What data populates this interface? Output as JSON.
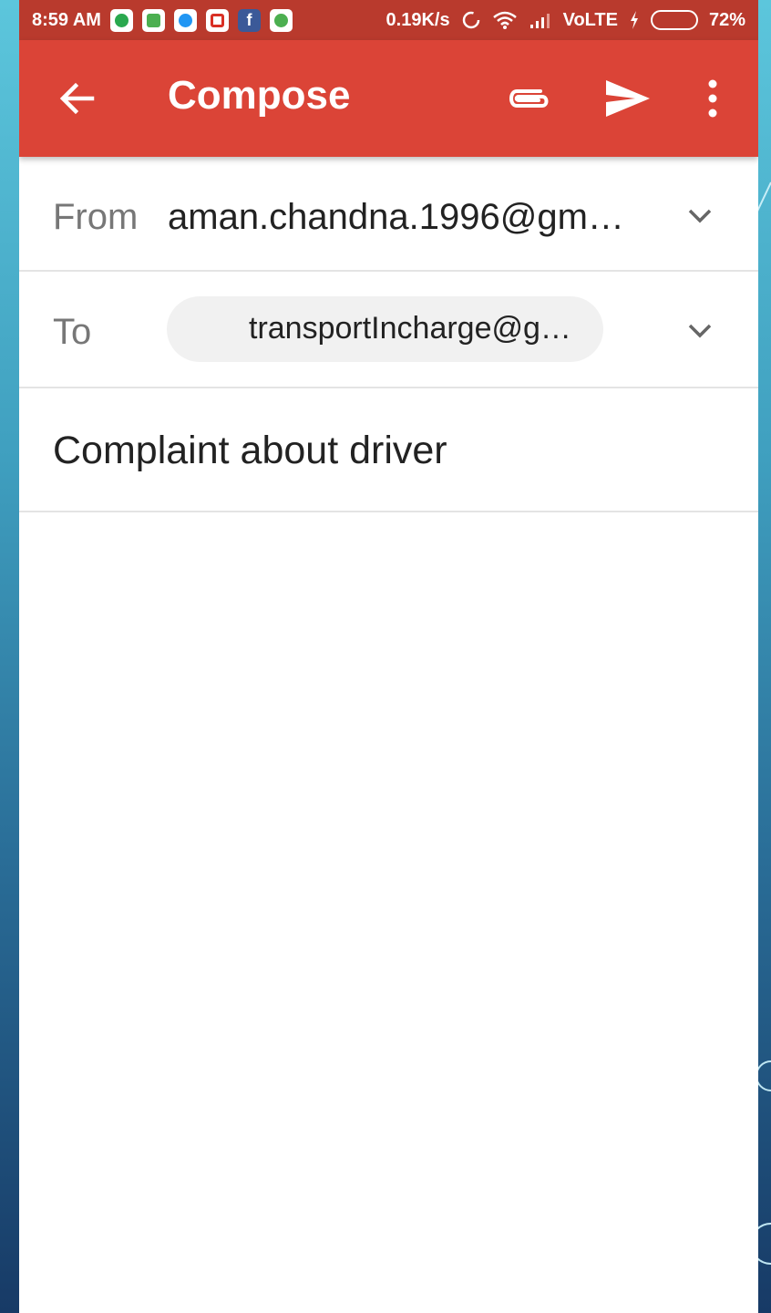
{
  "status_bar": {
    "time": "8:59 AM",
    "speed": "0.19K/s",
    "network": "VoLTE",
    "battery": "72%",
    "battery_level": 0.72,
    "app_icons": [
      "hangouts-icon",
      "sim-icon",
      "messenger-icon",
      "gmail-icon",
      "facebook-icon",
      "android-icon"
    ]
  },
  "app_bar": {
    "title": "Compose",
    "actions": [
      "back-arrow-icon",
      "attach-icon",
      "send-icon",
      "more-vert-icon"
    ]
  },
  "compose": {
    "from_label": "From",
    "from_value": "aman.chandna.1996@gm…",
    "to_label": "To",
    "to_recipient": "transportIncharge@g…",
    "subject": "Complaint about driver",
    "body": ""
  },
  "colors": {
    "app_bar": "#db4437",
    "status_bar": "#b93a2d",
    "battery_fill": "#27c33b"
  }
}
